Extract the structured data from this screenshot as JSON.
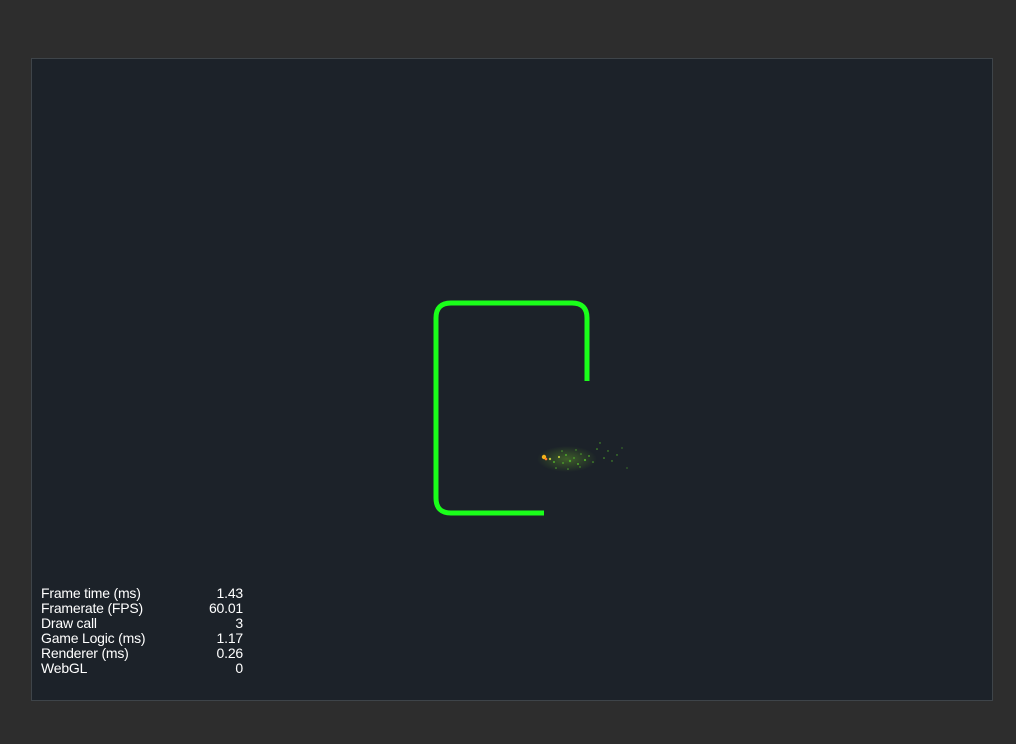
{
  "colors": {
    "page_background": "#2d2d2d",
    "canvas_background": "#1c2229",
    "canvas_border": "#3e4449",
    "line": "#1aff1a",
    "particle": "#4fa82a",
    "particle_bright": "#f2b21a",
    "stats_text": "#ffffff"
  },
  "stats": [
    {
      "label": "Frame time (ms)",
      "value": "1.43"
    },
    {
      "label": "Framerate (FPS)",
      "value": "60.01"
    },
    {
      "label": "Draw call",
      "value": "3"
    },
    {
      "label": "Game Logic (ms)",
      "value": "1.17"
    },
    {
      "label": "Renderer (ms)",
      "value": "0.26"
    },
    {
      "label": "WebGL",
      "value": "0"
    }
  ]
}
